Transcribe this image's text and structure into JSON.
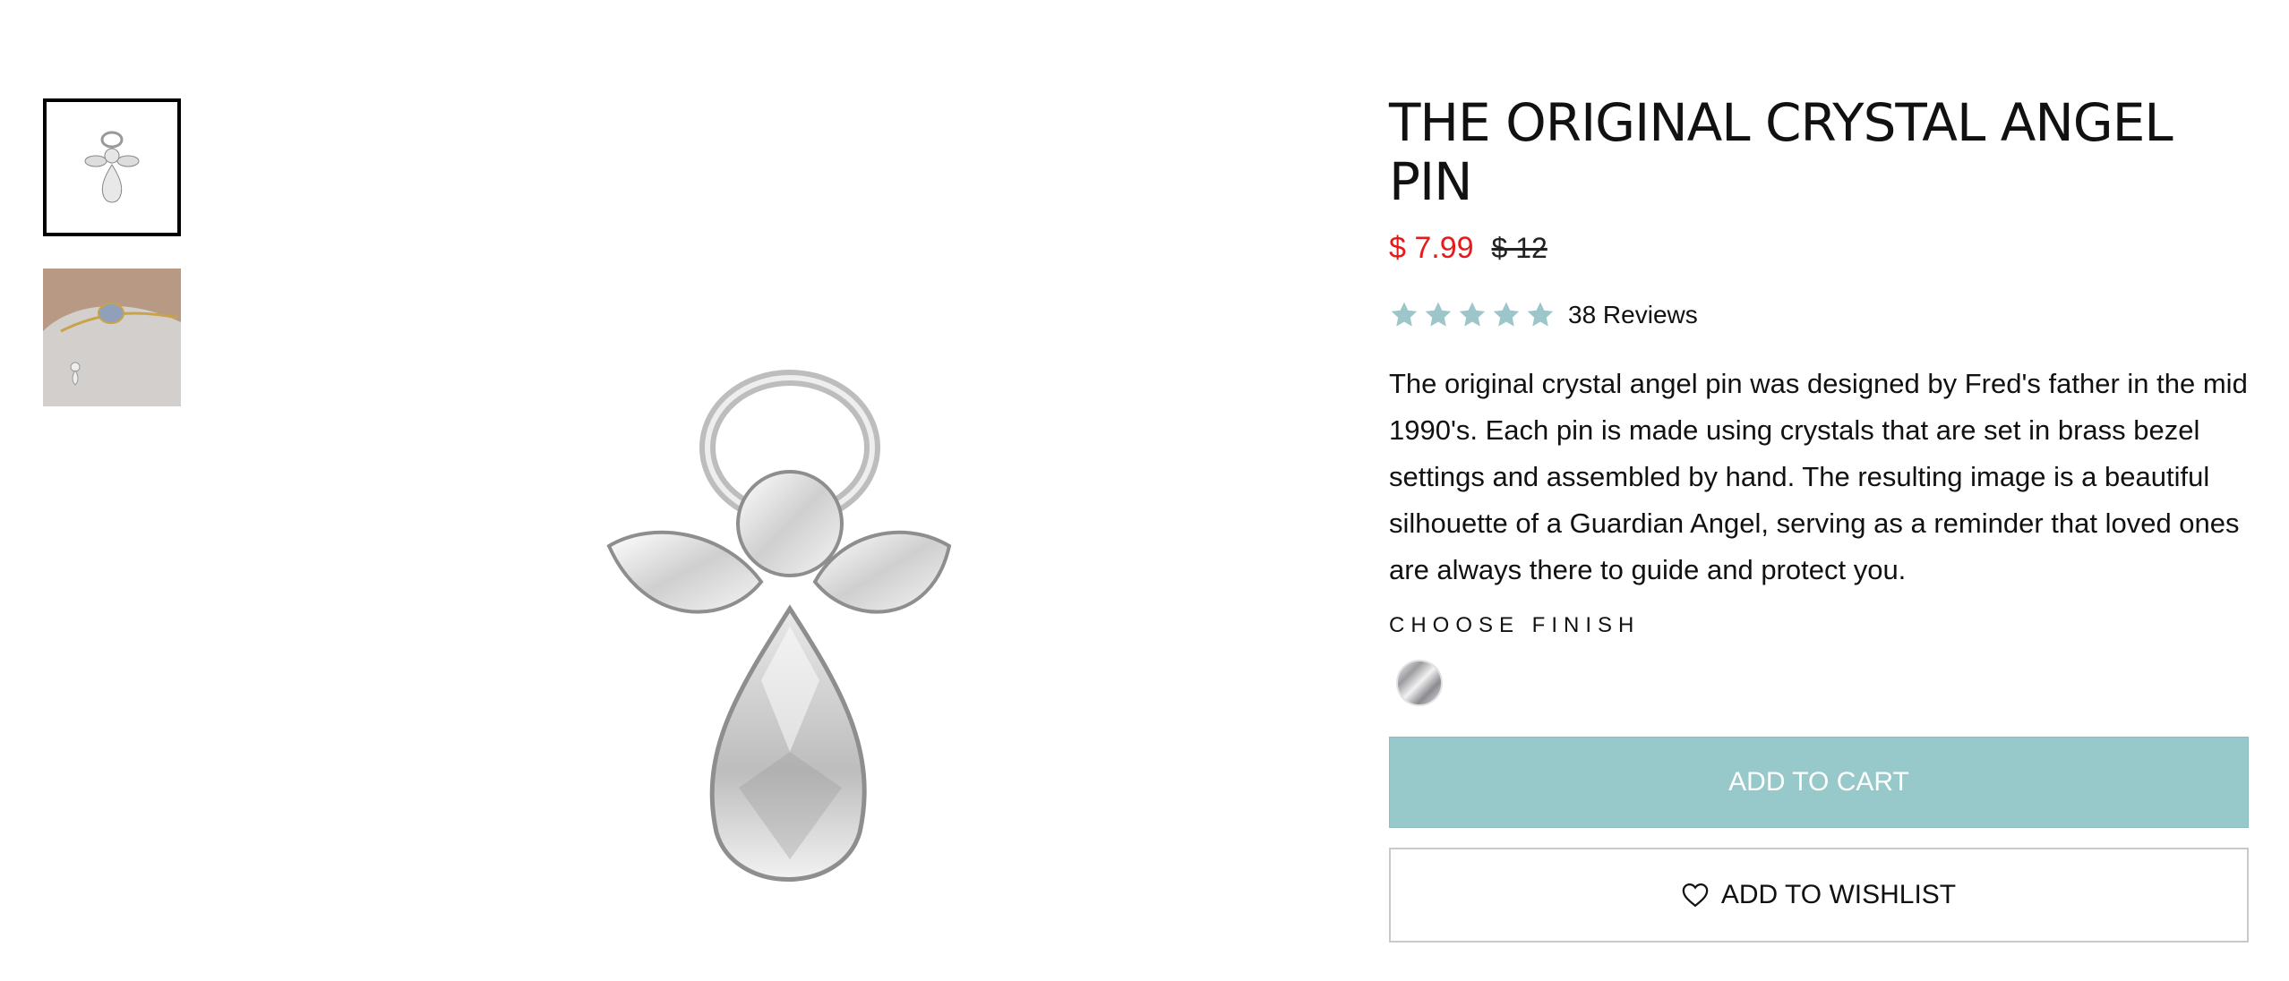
{
  "product": {
    "title": "THE ORIGINAL CRYSTAL ANGEL PIN",
    "price_sale": "$ 7.99",
    "price_original": "$ 12",
    "rating": 5,
    "rating_max": 5,
    "reviews_label": "38 Reviews",
    "description": "The original crystal angel pin was designed by Fred's father in the mid 1990's. Each pin is made using crystals that are set in brass bezel settings and assembled by hand. The resulting image is a beautiful silhouette of a Guardian Angel, serving as a reminder that loved ones are always there to guide and protect you.",
    "finish_label": "CHOOSE FINISH",
    "finish_selected": "silver"
  },
  "actions": {
    "add_to_cart": "ADD TO CART",
    "add_to_wishlist": "ADD TO WISHLIST"
  },
  "gallery": {
    "thumbnails": [
      "angel-pin-thumbnail",
      "bracelet-photo-thumbnail"
    ],
    "active_index": 0
  },
  "colors": {
    "accent": "#97c9cb",
    "sale_price": "#e51b1b",
    "star": "#9cc6c9"
  },
  "icons": [
    "star-icon",
    "heart-icon"
  ]
}
